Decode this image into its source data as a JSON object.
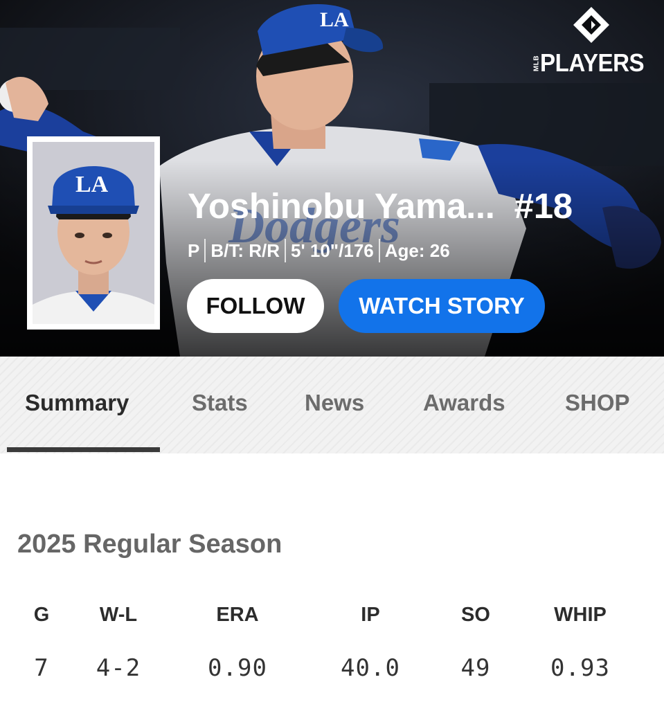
{
  "brand": {
    "mark_icon": "mlb-players-diamond-logo",
    "sub_label": "MLB",
    "label": "PLAYERS"
  },
  "player": {
    "name": "Yoshinobu Yama...",
    "number": "#18",
    "position": "P",
    "bats_throws": "B/T: R/R",
    "height_weight": "5' 10\"/176",
    "age": "Age: 26",
    "cap_logo": "LA"
  },
  "actions": {
    "follow_label": "FOLLOW",
    "watch_story_label": "WATCH STORY"
  },
  "tabs": [
    {
      "label": "Summary",
      "active": true
    },
    {
      "label": "Stats",
      "active": false
    },
    {
      "label": "News",
      "active": false
    },
    {
      "label": "Awards",
      "active": false
    },
    {
      "label": "SHOP",
      "active": false
    }
  ],
  "season": {
    "title": "2025 Regular Season",
    "columns": [
      "G",
      "W-L",
      "ERA",
      "IP",
      "SO",
      "WHIP"
    ],
    "values": [
      "7",
      "4-2",
      "0.90",
      "40.0",
      "49",
      "0.93"
    ]
  },
  "colors": {
    "accent_blue": "#1273ea",
    "dodger_blue": "#1f4fb4",
    "hero_bg": "#0c0d10",
    "tab_text": "#6c6c6c",
    "tab_active": "#2a2a2a"
  }
}
